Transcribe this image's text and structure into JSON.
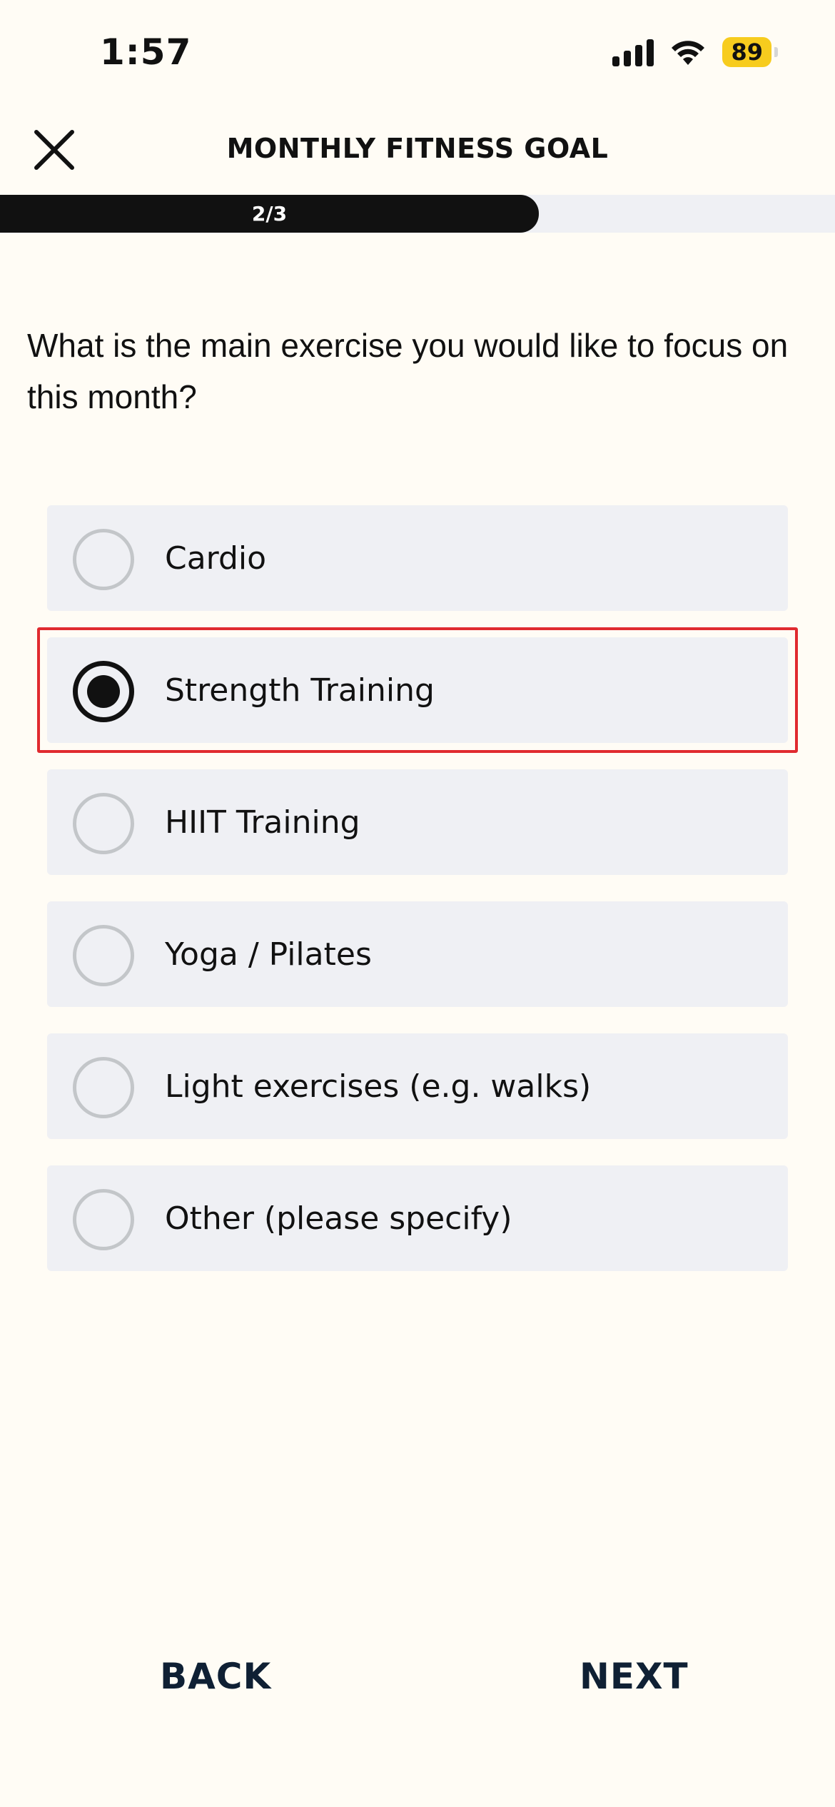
{
  "status_bar": {
    "time": "1:57",
    "battery": "89",
    "icons": [
      "signal-icon",
      "wifi-icon",
      "battery-icon"
    ]
  },
  "header": {
    "title": "MONTHLY FITNESS GOAL",
    "close_icon": "close-icon"
  },
  "progress": {
    "label": "2/3",
    "fraction": 0.667
  },
  "question": "What is the main exercise you would like to focus on this month?",
  "options": [
    {
      "label": "Cardio",
      "selected": false
    },
    {
      "label": "Strength Training",
      "selected": true
    },
    {
      "label": "HIIT Training",
      "selected": false
    },
    {
      "label": "Yoga / Pilates",
      "selected": false
    },
    {
      "label": "Light exercises (e.g. walks)",
      "selected": false
    },
    {
      "label": "Other (please specify)",
      "selected": false
    }
  ],
  "footer": {
    "back_label": "BACK",
    "next_label": "NEXT"
  },
  "colors": {
    "background": "#fffcf5",
    "option_background": "#eff0f4",
    "progress_fill": "#111111",
    "battery": "#f7cc1e",
    "highlight": "#e02a2f",
    "footer_text": "#0f2034"
  }
}
